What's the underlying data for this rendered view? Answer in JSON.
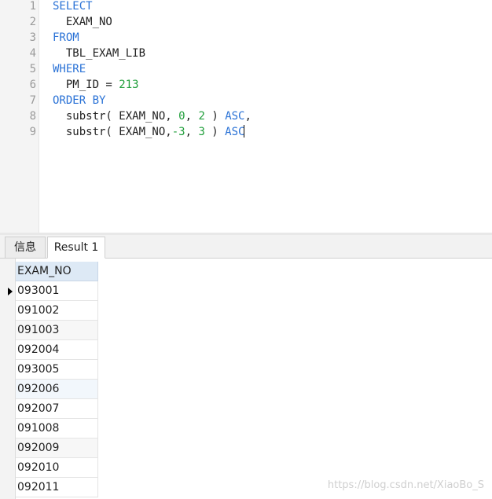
{
  "editor": {
    "line_numbers": [
      "1",
      "2",
      "3",
      "4",
      "5",
      "6",
      "7",
      "8",
      "9"
    ],
    "code": {
      "l1": {
        "kw": "SELECT"
      },
      "l2": {
        "text": "  EXAM_NO"
      },
      "l3": {
        "kw": "FROM"
      },
      "l4": {
        "text": "  TBL_EXAM_LIB"
      },
      "l5": {
        "kw": "WHERE"
      },
      "l6": {
        "pre": "  PM_ID = ",
        "num": "213"
      },
      "l7": {
        "kw": "ORDER BY"
      },
      "l8": {
        "pre": "  substr( EXAM_NO, ",
        "n1": "0",
        "sep": ", ",
        "n2": "2",
        "post": " ) ",
        "kw": "ASC",
        "tail": ","
      },
      "l9": {
        "pre": "  substr( EXAM_NO,",
        "n1": "-3",
        "sep": ", ",
        "n2": "3",
        "post": " ) ",
        "kw": "ASC"
      }
    }
  },
  "tabs": {
    "info": "信息",
    "result": "Result 1"
  },
  "grid": {
    "column_header": "EXAM_NO",
    "rows": [
      "093001",
      "091002",
      "091003",
      "092004",
      "093005",
      "092006",
      "092007",
      "091008",
      "092009",
      "092010",
      "092011"
    ]
  },
  "watermark": "https://blog.csdn.net/XiaoBo_S",
  "colors": {
    "keyword": "#2a72d6",
    "number": "#1f9e3a",
    "header_bg": "#dde9f5"
  }
}
